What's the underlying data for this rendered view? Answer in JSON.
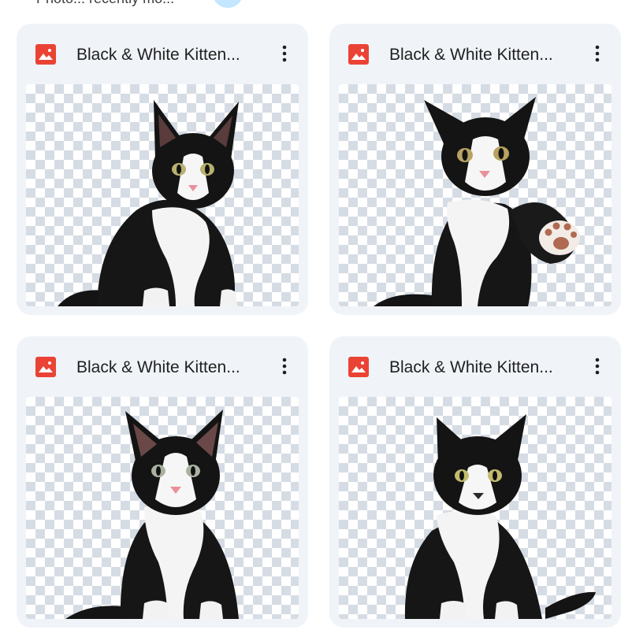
{
  "header": {
    "partial_text": "Photo... recently mo..."
  },
  "files": [
    {
      "title": "Black & White Kitten...",
      "type_icon": "image-file-icon",
      "more_icon": "more-vert-icon",
      "subject": "kitten-sitting"
    },
    {
      "title": "Black & White Kitten...",
      "type_icon": "image-file-icon",
      "more_icon": "more-vert-icon",
      "subject": "kitten-waving-paw"
    },
    {
      "title": "Black & White Kitten...",
      "type_icon": "image-file-icon",
      "more_icon": "more-vert-icon",
      "subject": "kitten-sitting-front"
    },
    {
      "title": "Black & White Kitten...",
      "type_icon": "image-file-icon",
      "more_icon": "more-vert-icon",
      "subject": "kitten-sitting-tail"
    }
  ],
  "colors": {
    "card_bg": "#f0f4f9",
    "image_icon_red": "#ea4335",
    "text": "#1f1f1f",
    "accent_chip": "#c2e7ff"
  }
}
